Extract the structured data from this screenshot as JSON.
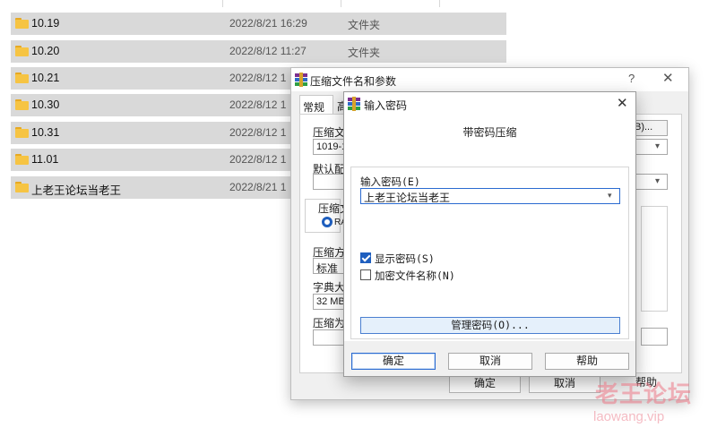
{
  "explorer": {
    "rows": [
      {
        "name": "10.19",
        "date": "2022/8/21 16:29",
        "type": "文件夹"
      },
      {
        "name": "10.20",
        "date": "2022/8/12 11:27",
        "type": "文件夹"
      },
      {
        "name": "10.21",
        "date": "2022/8/12 1",
        "type": ""
      },
      {
        "name": "10.30",
        "date": "2022/8/12 1",
        "type": ""
      },
      {
        "name": "10.31",
        "date": "2022/8/12 1",
        "type": ""
      },
      {
        "name": "11.01",
        "date": "2022/8/12 1",
        "type": ""
      },
      {
        "name": "上老王论坛当老王",
        "date": "2022/8/21 1",
        "type": ""
      }
    ]
  },
  "archive_dialog": {
    "title": "压缩文件名和参数",
    "help": "?",
    "close": "✕",
    "tab_general": "常规",
    "tab_advanced": "高",
    "archive_name_label": "压缩文",
    "archive_name_value": "1019-1",
    "browse_label": "B)...",
    "profile_label": "默认配",
    "format_group_label": "压缩文",
    "format_rar": "RA",
    "method_label": "压缩方",
    "method_value": "标准",
    "dict_label": "字典大",
    "dict_value": "32 MB",
    "split_label": "压缩为",
    "ok_label": "确定",
    "cancel_label": "取消",
    "help_label": "帮助"
  },
  "password_dialog": {
    "title": "输入密码",
    "close": "✕",
    "heading": "带密码压缩",
    "password_label": "输入密码(E)",
    "password_value": "上老王论坛当老王",
    "show_password_label": "显示密码(S)",
    "show_password_checked": true,
    "encrypt_names_label": "加密文件名称(N)",
    "encrypt_names_checked": false,
    "manage_label": "管理密码(O)...",
    "ok_label": "确定",
    "cancel_label": "取消",
    "help_label": "帮助"
  },
  "watermark": {
    "cn": "老王论坛",
    "url": "laowang.vip"
  }
}
